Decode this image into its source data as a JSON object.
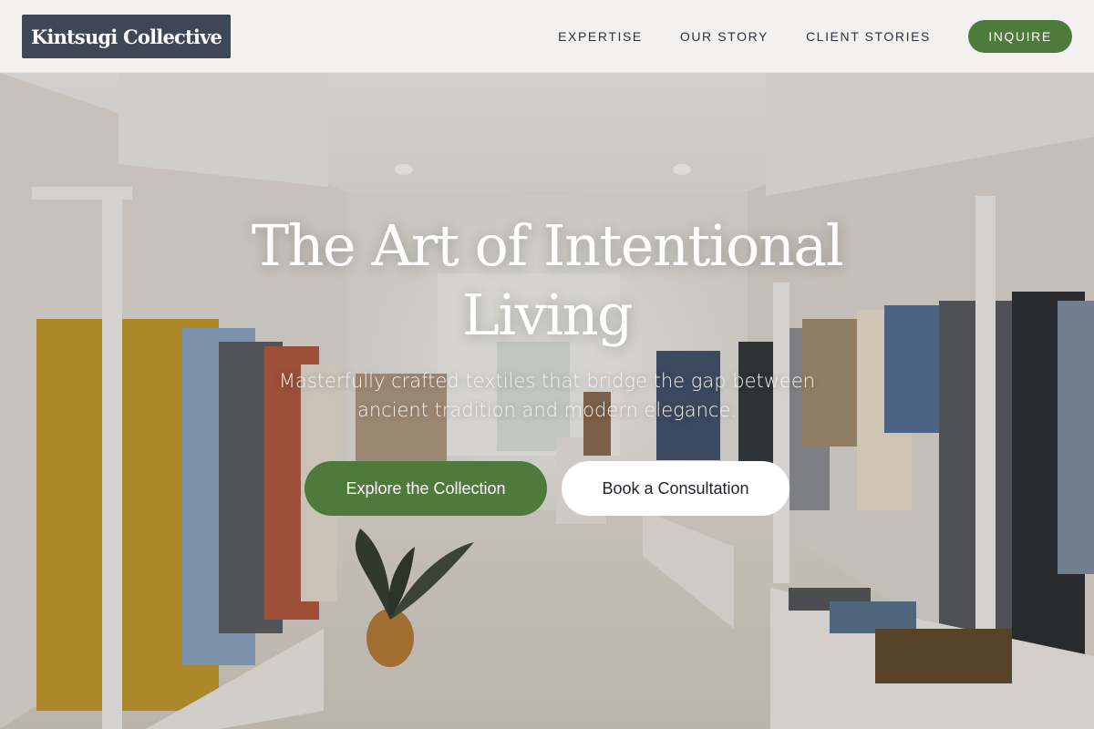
{
  "header": {
    "logo_text": "Kintsugi Collective",
    "nav": {
      "expertise": "EXPERTISE",
      "our_story": "OUR STORY",
      "client_stories": "CLIENT STORIES"
    },
    "inquire_label": "INQUIRE"
  },
  "hero": {
    "title_line1": "The Art of Intentional",
    "title_line2": "Living",
    "subtitle_line1": "Masterfully crafted textiles that bridge the gap between",
    "subtitle_line2": "ancient tradition and modern elegance.",
    "primary_cta": "Explore the Collection",
    "secondary_cta": "Book a Consultation"
  },
  "colors": {
    "accent_green": "#4e7a3b",
    "logo_bg": "#3e4756",
    "nav_text": "#2d3440"
  }
}
